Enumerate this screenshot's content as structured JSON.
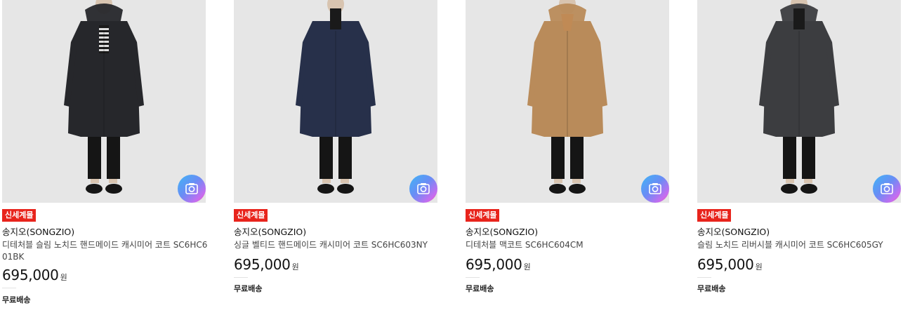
{
  "products": [
    {
      "badge": "신세계몰",
      "brand": "송지오(SONGZIO)",
      "name": "디테처블 슬림 노치드 핸드메이드 캐시미어 코트 SC6HC601BK",
      "price": "695,000",
      "currency": "원",
      "shipping": "무료배송",
      "coat_color": "#26272b",
      "inner": "stripe",
      "hood": true
    },
    {
      "badge": "신세계몰",
      "brand": "송지오(SONGZIO)",
      "name": "싱글 벨티드 핸드메이드 캐시미어 코트 SC6HC603NY",
      "price": "695,000",
      "currency": "원",
      "shipping": "무료배송",
      "coat_color": "#27304a",
      "inner": "turtleneck",
      "hood": false
    },
    {
      "badge": "신세계몰",
      "brand": "송지오(SONGZIO)",
      "name": "디테처블 맥코트 SC6HC604CM",
      "price": "695,000",
      "currency": "원",
      "shipping": "무료배송",
      "coat_color": "#b98b5a",
      "inner": "collar",
      "hood": true
    },
    {
      "badge": "신세계몰",
      "brand": "송지오(SONGZIO)",
      "name": "슬림 노치드 리버시블 캐시미어 코트 SC6HC605GY",
      "price": "695,000",
      "currency": "원",
      "shipping": "무료배송",
      "coat_color": "#3c3d40",
      "inner": "turtleneck",
      "hood": true
    }
  ],
  "icons": {
    "lens": "camera-lens-icon"
  },
  "colors": {
    "badge": "#e8241c",
    "thumb_bg": "#e6e6e6"
  }
}
